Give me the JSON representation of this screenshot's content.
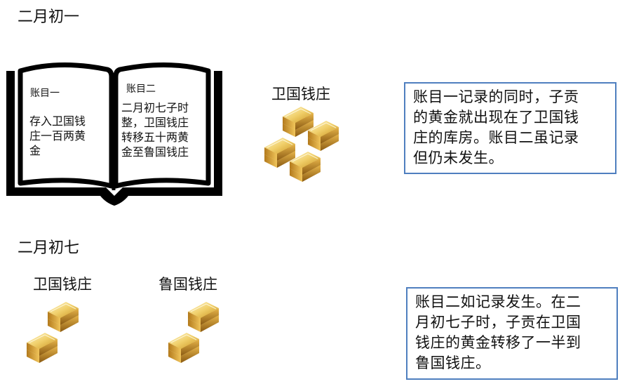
{
  "feb1": {
    "heading": "二月初一",
    "book": {
      "left_title": "账目一",
      "left_lines": [
        "存入卫国钱",
        "庄一百两黄",
        "金"
      ],
      "right_title": "账目二",
      "right_lines": [
        "二月初七子时",
        "整，卫国钱庄",
        "转移五十两黄",
        "金至鲁国钱庄"
      ]
    },
    "bank_label": "卫国钱庄",
    "note_lines": [
      "账目一记录的同时，子贡",
      "的黄金就出现在了卫国钱",
      "庄的库房。账目二虽记录",
      "但仍未发生。"
    ]
  },
  "feb7": {
    "heading": "二月初七",
    "bank_wei": "卫国钱庄",
    "bank_lu": "鲁国钱庄",
    "note_lines": [
      "账目二如记录发生。在二",
      "月初七子时，子贡在卫国",
      "钱庄的黄金转移了一半到",
      "鲁国钱庄。"
    ]
  },
  "colors": {
    "note_border": "#4f7fbf",
    "gold_light": "#f6e7a0",
    "gold_mid": "#d9a93a",
    "gold_dark": "#8a5a12"
  },
  "icons": {
    "book": "open-book-icon",
    "gold": "gold-bars-icon"
  }
}
